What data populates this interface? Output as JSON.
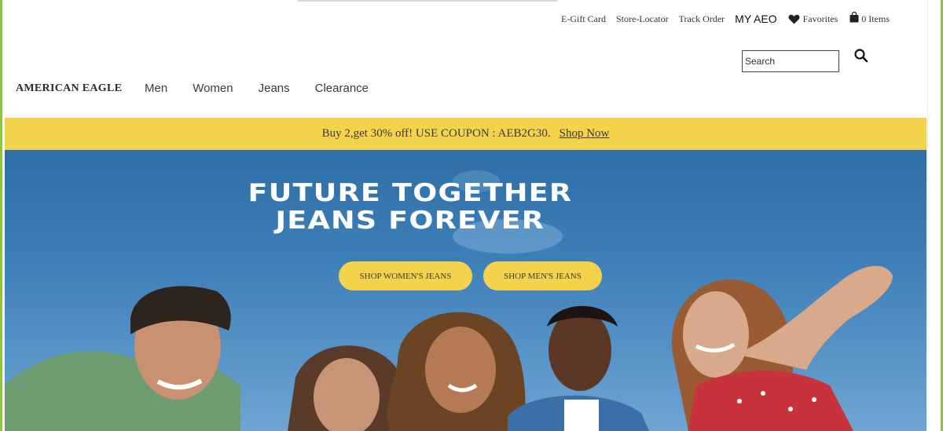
{
  "utility": {
    "links": [
      "E-Gift Card",
      "Store-Locator",
      "Track Order"
    ],
    "myaeo": "MY AEO",
    "favorites": "Favorites",
    "cart": "0 Items"
  },
  "search": {
    "placeholder": "Search"
  },
  "brand": "AMERICAN EAGLE",
  "nav": [
    "Men",
    "Women",
    "Jeans",
    "Clearance"
  ],
  "promo": {
    "text": "Buy 2,get 30% off! USE COUPON : AEB2G30.",
    "link": "Shop Now",
    "color": "#f4d34c"
  },
  "hero": {
    "title_line1": "FUTURE TOGETHER",
    "title_line2": "JEANS FOREVER",
    "buttons": [
      "SHOP WOMEN'S JEANS",
      "SHOP MEN'S JEANS"
    ],
    "sky_color": "#3d80b8"
  },
  "icons": [
    "heart-icon",
    "shopping-bag-icon",
    "search-icon"
  ]
}
